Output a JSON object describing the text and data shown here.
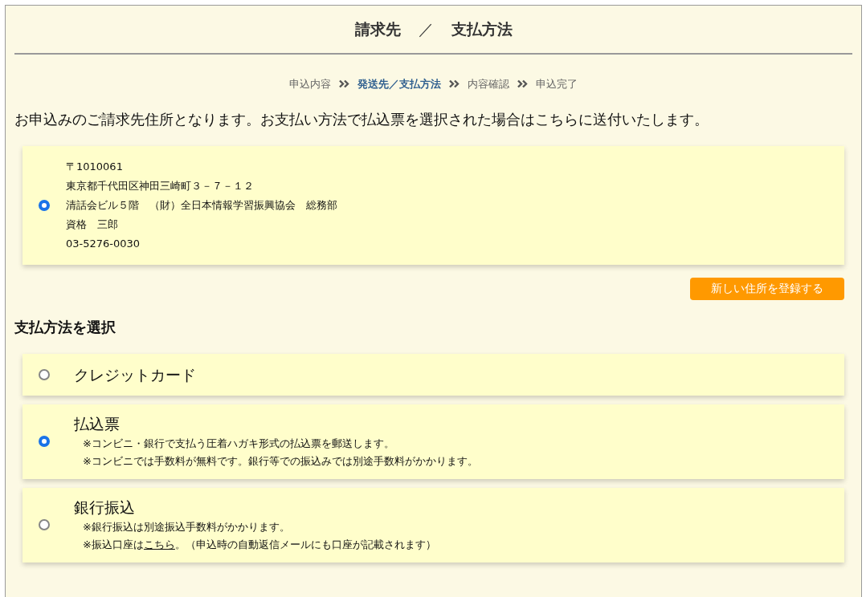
{
  "title": {
    "left": "請求先",
    "separator": "／",
    "right": "支払方法"
  },
  "steps": [
    {
      "label": "申込内容",
      "selected": false
    },
    {
      "label": "発送先／支払方法",
      "selected": true
    },
    {
      "label": "内容確認",
      "selected": false
    },
    {
      "label": "申込完了",
      "selected": false
    }
  ],
  "intro": "お申込みのご請求先住所となります。お支払い方法で払込票を選択された場合はこちらに送付いたします。",
  "addresses": [
    {
      "selected": true,
      "lines": [
        "〒1010061",
        "東京都千代田区神田三崎町３－７－１２",
        "清話会ビル５階　（財）全日本情報学習振興協会　総務部",
        "資格　三郎",
        "03-5276-0030"
      ]
    }
  ],
  "new_address_button": "新しい住所を登録する",
  "payment_heading": "支払方法を選択",
  "payment_methods": [
    {
      "label": "クレジットカード",
      "selected": false
    },
    {
      "label": "払込票",
      "selected": true,
      "notes": [
        {
          "kind": "plain",
          "text": "※コンビニ・銀行で支払う圧着ハガキ形式の払込票を郵送します。"
        },
        {
          "kind": "plain",
          "text": "※コンビニでは手数料が無料です。銀行等での振込みでは別途手数料がかかります。"
        }
      ]
    },
    {
      "label": "銀行振込",
      "selected": false,
      "notes": [
        {
          "kind": "plain",
          "text": "※銀行振込は別途振込手数料がかかります。"
        },
        {
          "kind": "link",
          "before": "※振込口座は",
          "link": "こちら",
          "after": "。（申込時の自動返信メールにも口座が記載されます）"
        }
      ]
    }
  ]
}
